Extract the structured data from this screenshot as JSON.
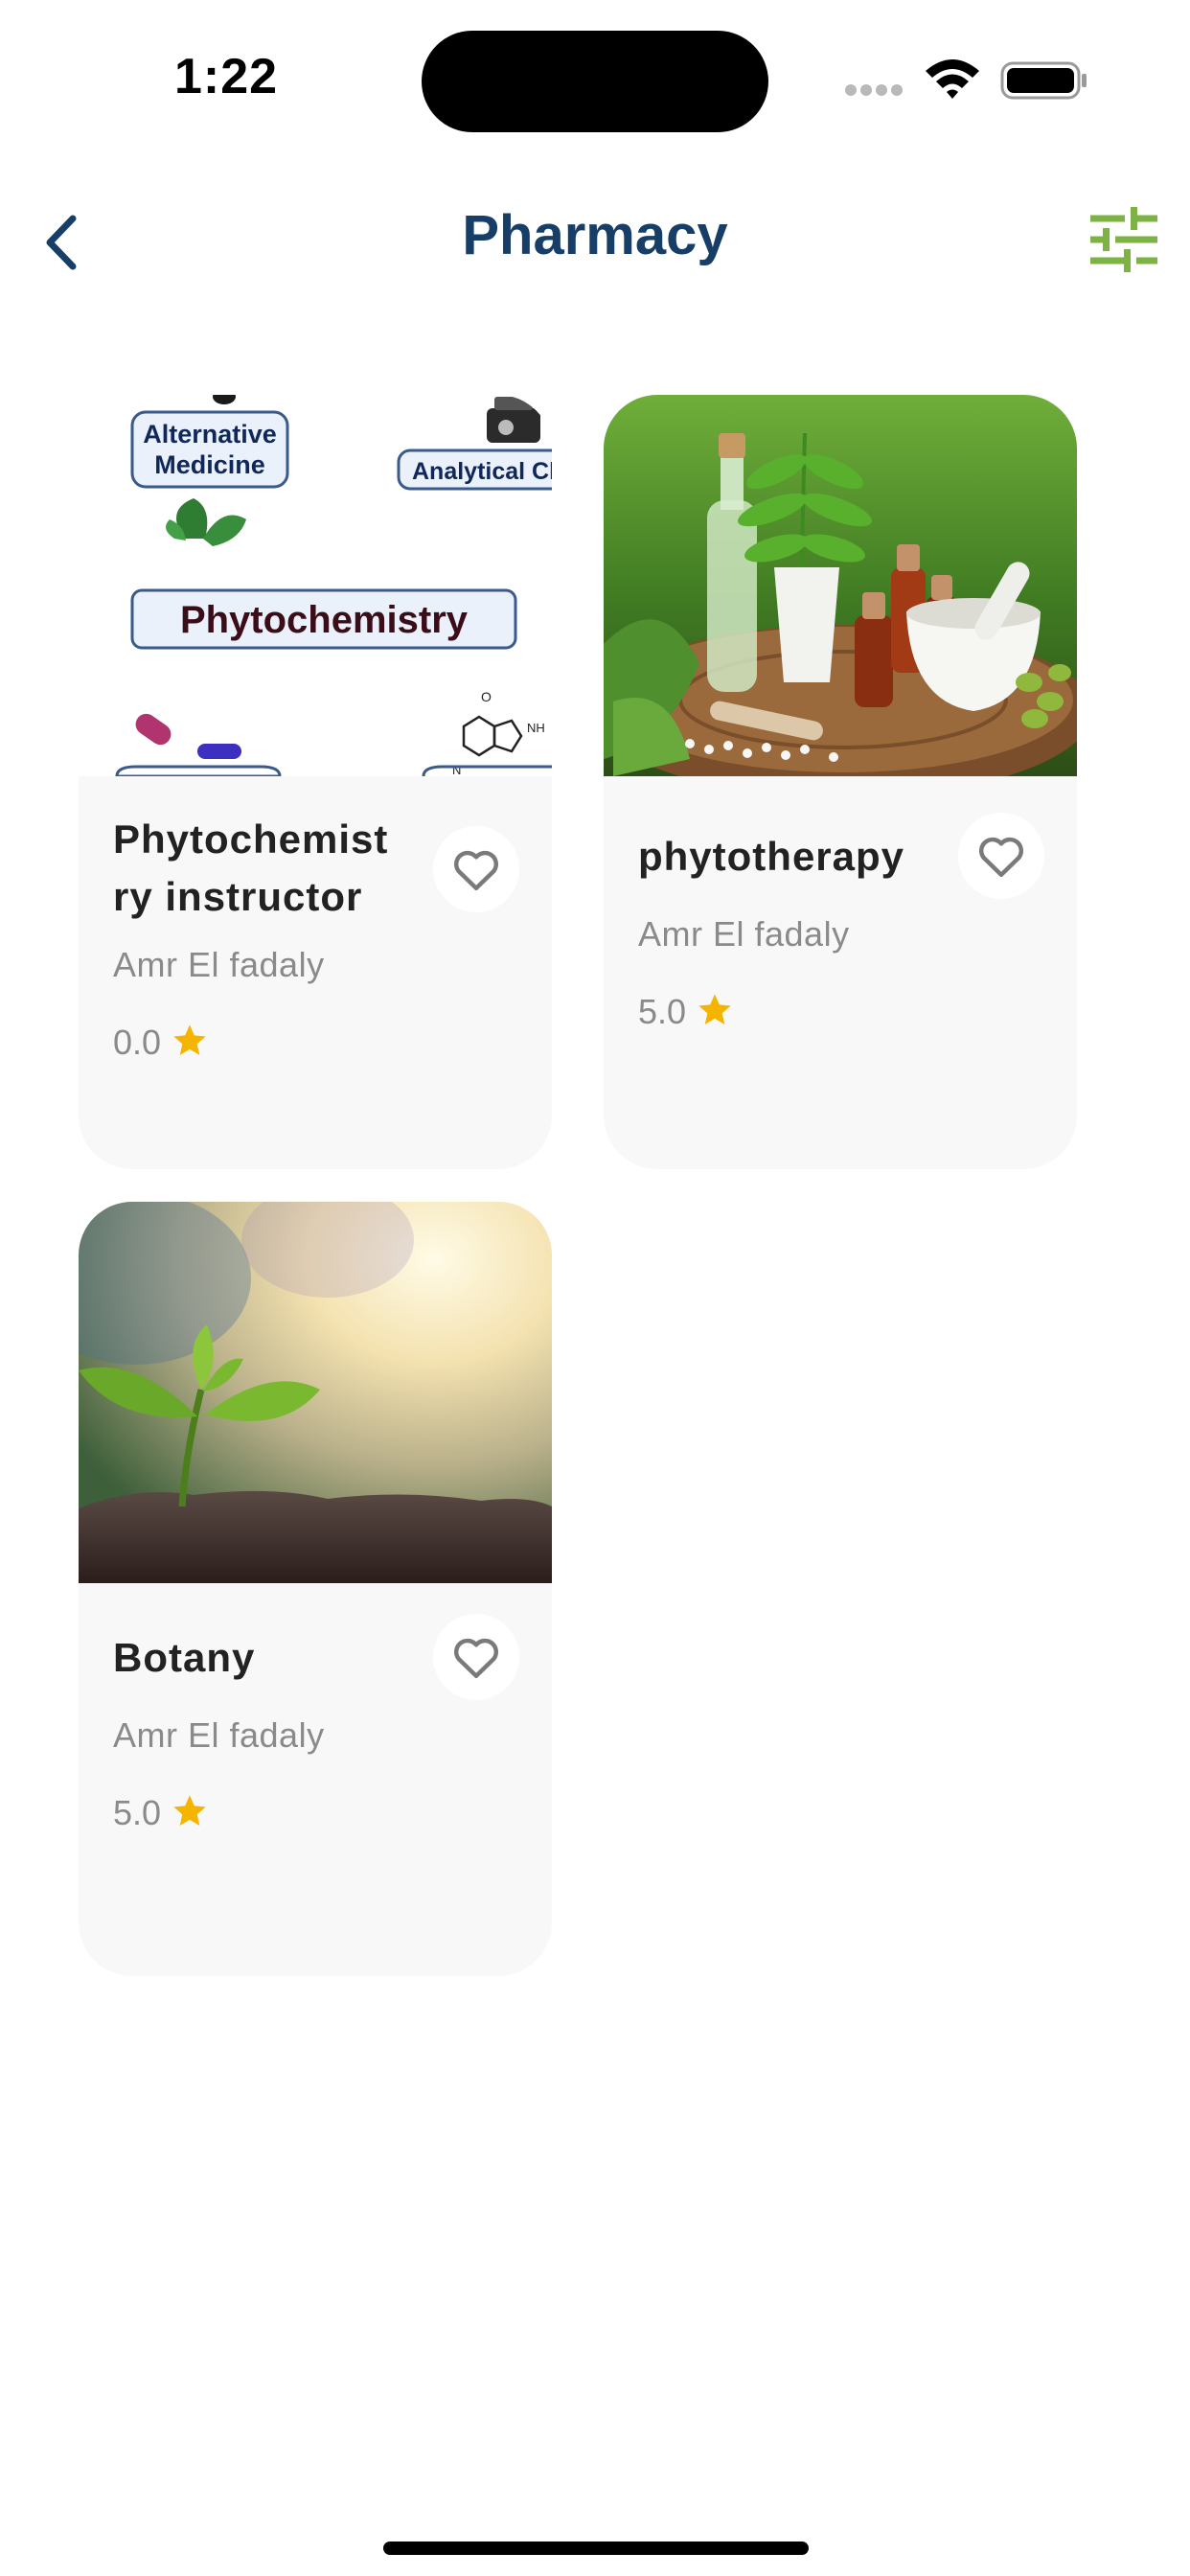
{
  "status_bar": {
    "time": "1:22"
  },
  "header": {
    "title": "Pharmacy"
  },
  "colors": {
    "title": "#173e66",
    "accent_green": "#7cb342",
    "star": "#f5b400"
  },
  "courses": [
    {
      "title": "Phytochemistry instructor",
      "title_line1": "Phytochemist",
      "title_line2": "ry instructor",
      "author": "Amr El fadaly",
      "rating": "0.0",
      "image_labels": {
        "alt_line1": "Alternative",
        "alt_line2": "Medicine",
        "analytical": "Analytical Ch",
        "main": "Phytochemistry"
      }
    },
    {
      "title": "phytotherapy",
      "author": "Amr El fadaly",
      "rating": "5.0"
    },
    {
      "title": "Botany",
      "author": "Amr El fadaly",
      "rating": "5.0"
    }
  ]
}
